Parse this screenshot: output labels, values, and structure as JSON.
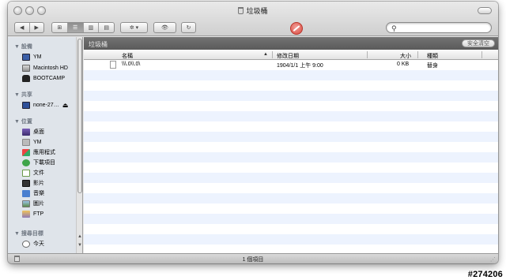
{
  "window": {
    "title": "垃圾桶"
  },
  "toolbar": {
    "back": "◀",
    "forward": "▶",
    "views": [
      "⊞",
      "☰",
      "▥",
      "▤"
    ],
    "action": "✲ ▾",
    "quicklook": "👁",
    "refresh": "↻",
    "search_placeholder": "",
    "search_value": ""
  },
  "sidebar": {
    "sections": [
      {
        "title": "▼ 設備",
        "items": [
          "YM",
          "Macintosh HD",
          "BOOTCAMP"
        ]
      },
      {
        "title": "▼ 共享",
        "items": [
          "none-27…"
        ]
      },
      {
        "title": "▼ 位置",
        "items": [
          "桌面",
          "YM",
          "應用程式",
          "下載項目",
          "文件",
          "影片",
          "音樂",
          "圖片",
          "FTP"
        ]
      },
      {
        "title": "▼ 搜尋目標",
        "items": [
          "今天"
        ]
      }
    ],
    "eject": "⏏"
  },
  "path": {
    "label": "垃圾桶",
    "empty_button": "安全清空"
  },
  "columns": {
    "name": "名稱",
    "modified": "修改日期",
    "size": "大小",
    "kind": "種類"
  },
  "files": [
    {
      "name": "\\\\\\.0\\\\.0\\",
      "modified": "1904/1/1 上午 9:00",
      "size": "0 KB",
      "kind": "替身"
    }
  ],
  "status": {
    "count": "1 個項目"
  },
  "watermark": "#274206",
  "colors": {
    "path_bar": "#666666",
    "row_stripe": "#edf3fe",
    "sidebar_bg": "#dfe4ea"
  }
}
